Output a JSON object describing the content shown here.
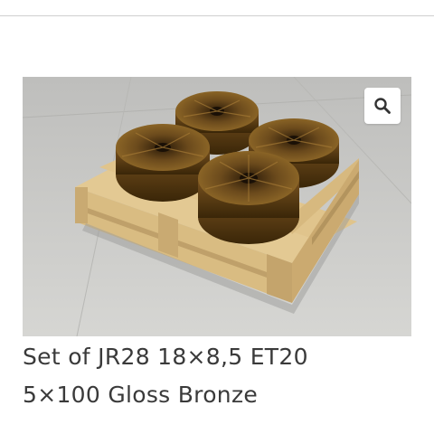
{
  "header": {},
  "product": {
    "image_alt": "Four gloss bronze wheels on a wooden pallet",
    "title_line_1": "Set of JR28 18×8,5 ET20",
    "title_line_2": "5×100 Gloss Bronze",
    "wheel_color": "#6b4a1c",
    "pallet_color": "#dcc08a"
  },
  "controls": {
    "zoom_icon": "magnifier-icon"
  }
}
